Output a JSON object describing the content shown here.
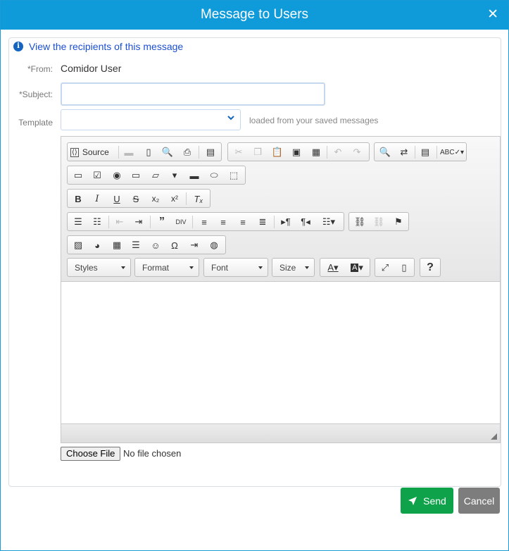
{
  "window": {
    "title": "Message to Users",
    "close_icon": "close-icon"
  },
  "recipients_link": "View the recipients of this message",
  "form": {
    "from_label": "*From:",
    "from_value": "Comidor User",
    "subject_label": "*Subject:",
    "subject_value": "",
    "template_label": "Template",
    "template_value": "",
    "template_hint": "loaded from your saved messages"
  },
  "editor": {
    "source_label": "Source",
    "combos": {
      "styles": "Styles",
      "format": "Format",
      "font": "Font",
      "size": "Size"
    },
    "content": ""
  },
  "file": {
    "button": "Choose File",
    "status": "No file chosen"
  },
  "actions": {
    "send": "Send",
    "cancel": "Cancel"
  },
  "colors": {
    "header": "#0f9ad9",
    "send": "#0ea34a",
    "cancel": "#7d7d7d",
    "link": "#1b4fd1"
  }
}
